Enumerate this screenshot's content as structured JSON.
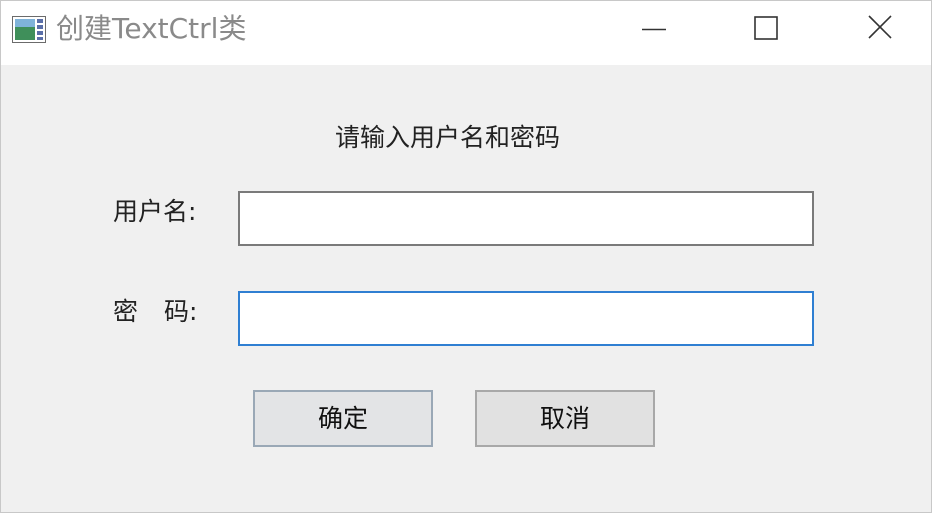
{
  "window": {
    "title": "创建TextCtrl类",
    "icon": "app-window-icon"
  },
  "caption_buttons": {
    "minimize_icon": "minimize-icon",
    "maximize_icon": "maximize-icon",
    "close_icon": "close-icon"
  },
  "form": {
    "heading": "请输入用户名和密码",
    "username_label": "用户名:",
    "password_label_char1": "密",
    "password_label_char2": "码:",
    "username_value": "",
    "password_value": "",
    "focused_field": "password"
  },
  "buttons": {
    "ok_label": "确定",
    "cancel_label": "取消"
  },
  "colors": {
    "focus_border": "#2f7fd2",
    "field_border": "#7a7a7a",
    "dialog_background": "#f0f0f0"
  }
}
